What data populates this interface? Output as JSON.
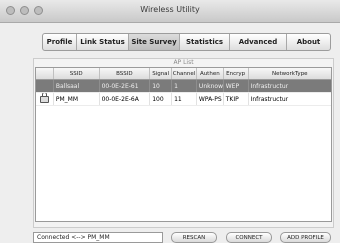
{
  "window": {
    "title": "Wireless Utility"
  },
  "tabs": [
    "Profile",
    "Link Status",
    "Site Survey",
    "Statistics",
    "Advanced",
    "About"
  ],
  "active_tab": "Site Survey",
  "ap_list": {
    "label": "AP List",
    "columns": [
      "",
      "SSID",
      "BSSID",
      "Signal",
      "Channel",
      "Authen",
      "Encryp",
      "NetworkType"
    ],
    "rows": [
      {
        "icon": "",
        "ssid": "Ballsaal",
        "bssid": "00-0E-2E-61",
        "signal": "10",
        "channel": "1",
        "authen": "Unknow",
        "encryp": "WEP",
        "network_type": "Infrastructur",
        "selected": true
      },
      {
        "icon": "lock-icon",
        "ssid": "PM_MM",
        "bssid": "00-0E-2E-6A",
        "signal": "100",
        "channel": "11",
        "authen": "WPA-PS",
        "encryp": "TKIP",
        "network_type": "Infrastructur",
        "selected": false
      }
    ]
  },
  "status": {
    "text": "Connected <--> PM_MM"
  },
  "buttons": {
    "rescan": "RESCAN",
    "connect": "CONNECT",
    "add_profile": "ADD PROFILE"
  }
}
